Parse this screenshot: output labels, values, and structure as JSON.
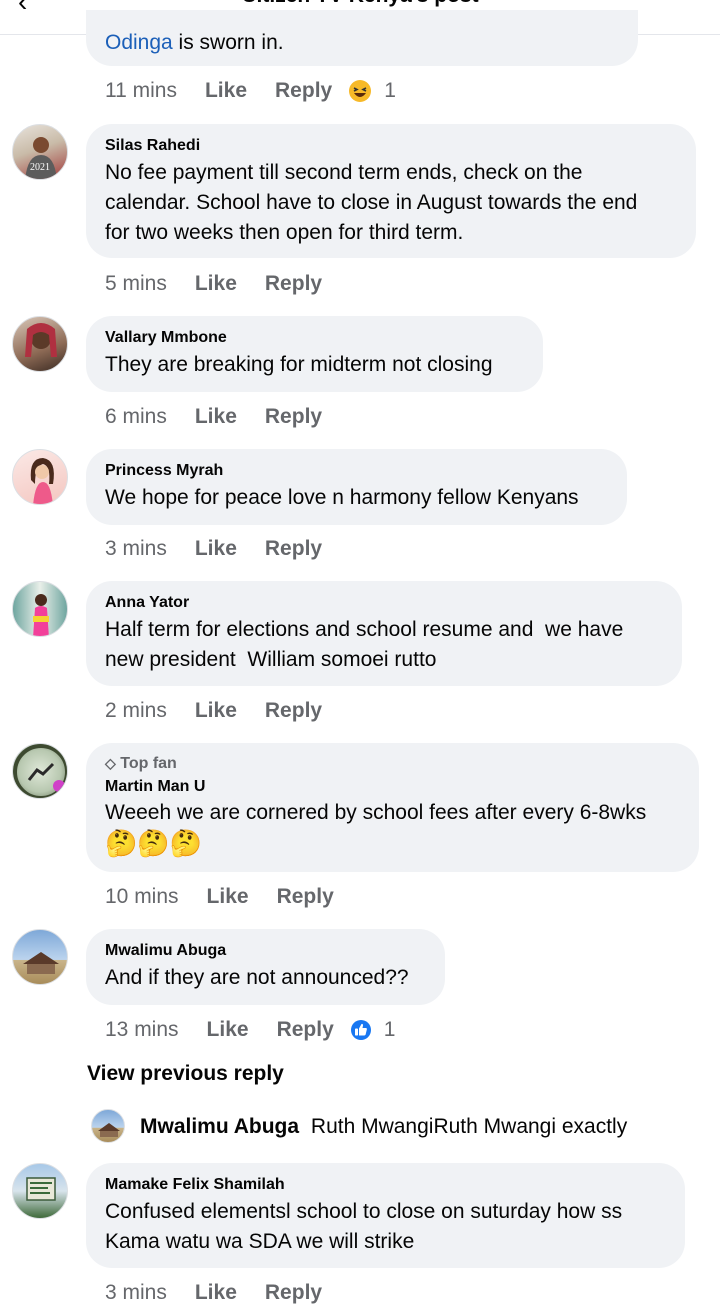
{
  "header": {
    "title": "Citizen TV Kenya's post"
  },
  "comments": [
    {
      "text_prefix": "Odinga",
      "text": " is sworn in.",
      "time": "11 mins",
      "like": "Like",
      "reply": "Reply",
      "reaction_icon": "haha-emoji",
      "reaction_count": "1"
    },
    {
      "author": "Silas Rahedi",
      "avatar_caption": "2021",
      "lines": [
        "No fee payment till second term ends, check on the",
        "calendar. School have to close in August towards the end",
        "for two weeks then open for third term."
      ],
      "time": "5 mins",
      "like": "Like",
      "reply": "Reply"
    },
    {
      "author": "Vallary Mmbone",
      "lines": [
        "They are breaking for midterm not closing"
      ],
      "time": "6 mins",
      "like": "Like",
      "reply": "Reply"
    },
    {
      "author": "Princess Myrah",
      "lines": [
        "We hope for peace love n harmony fellow Kenyans"
      ],
      "time": "3 mins",
      "like": "Like",
      "reply": "Reply"
    },
    {
      "author": "Anna Yator",
      "lines": [
        "Half term for elections and school resume and  we have",
        "new president  William somoei rutto"
      ],
      "time": "2 mins",
      "like": "Like",
      "reply": "Reply"
    },
    {
      "badge": "Top fan",
      "author": "Martin Man U",
      "lines": [
        "Weeeh we are cornered by school fees after every 6-8wks"
      ],
      "emoji": "🤔🤔🤔",
      "time": "10 mins",
      "like": "Like",
      "reply": "Reply"
    },
    {
      "author": "Mwalimu Abuga",
      "lines": [
        "And if they are not announced??"
      ],
      "time": "13 mins",
      "like": "Like",
      "reply": "Reply",
      "reaction_icon": "like-icon",
      "reaction_count": "1"
    },
    {
      "author": "Mamake Felix Shamilah",
      "lines": [
        "Confused elementsl school to close on suturday how ss",
        "Kama watu wa SDA we will strike"
      ],
      "time": "3 mins",
      "like": "Like",
      "reply": "Reply"
    }
  ],
  "view_previous": "View previous reply",
  "nested_reply": {
    "author": "Mwalimu Abuga",
    "text": "Ruth MwangiRuth Mwangi exactly"
  },
  "colors": {
    "bubble": "#f0f2f5",
    "meta": "#65676b",
    "link": "#1b5fb8",
    "like_blue": "#1877f2",
    "haha_yellow": "#f7b928"
  }
}
